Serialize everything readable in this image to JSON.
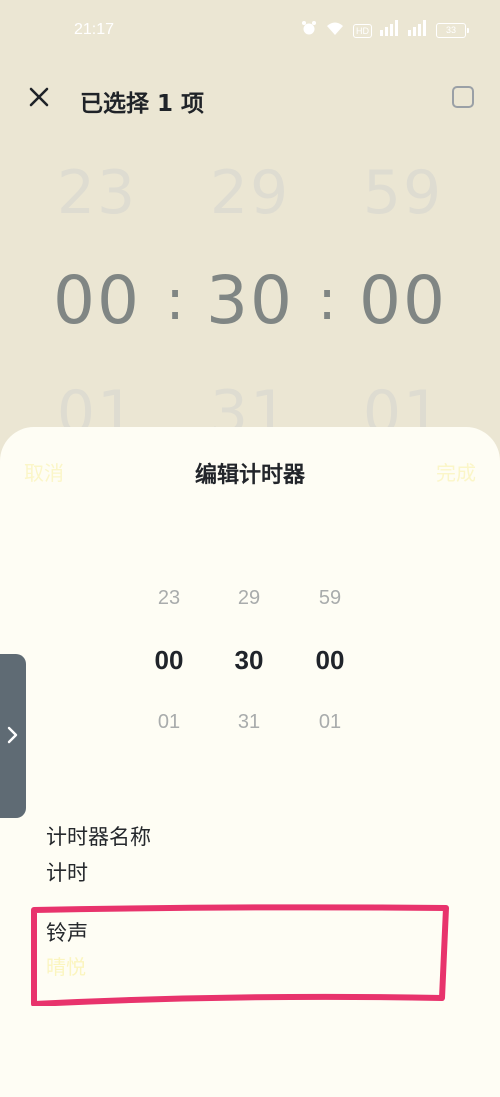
{
  "status_bar": {
    "time": "21:17",
    "hd_label": "HD",
    "battery": "33",
    "icons": [
      "alarm-icon",
      "wifi-icon",
      "hd-icon",
      "signal-icon",
      "signal-icon",
      "battery-icon"
    ]
  },
  "top_bar": {
    "title": "已选择 1 项",
    "close_icon": "close-icon",
    "select_all_icon": "checkbox-icon"
  },
  "background_picker": {
    "prev": [
      "23",
      "29",
      "59"
    ],
    "current": [
      "00",
      "30",
      "00"
    ],
    "next": [
      "01",
      "31",
      "01"
    ],
    "separator": ":"
  },
  "sheet": {
    "cancel_label": "取消",
    "title": "编辑计时器",
    "done_label": "完成",
    "picker": {
      "prev": [
        "23",
        "29",
        "59"
      ],
      "current": [
        "00",
        "30",
        "00"
      ],
      "next": [
        "01",
        "31",
        "01"
      ]
    },
    "name_label": "计时器名称",
    "name_value": "计时",
    "ringtone_label": "铃声",
    "ringtone_value": "晴悦"
  },
  "colors": {
    "background": "#ebe6d3",
    "sheet": "#fefdf4",
    "accent_yellow": "#fbf6c8",
    "highlight_red": "#e8336c",
    "side_handle": "#5f6b74"
  }
}
